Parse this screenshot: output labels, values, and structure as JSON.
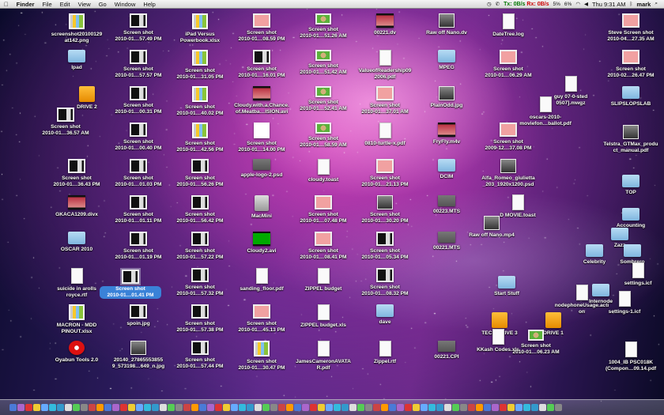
{
  "menubar": {
    "apple": "",
    "app": "Finder",
    "menus": [
      "File",
      "Edit",
      "View",
      "Go",
      "Window",
      "Help"
    ],
    "status": {
      "net_tx": "Tx:",
      "net_rx": "Rx:",
      "net_rate_tx": "0B/s",
      "net_rate_rx": "0B/s",
      "cpu1": "5%",
      "cpu2": "6%",
      "clock": "Thu 9:31 AM",
      "user": "mark"
    }
  },
  "items": [
    {
      "label": "screenshot20100129\nat142.png",
      "icon": "sheet"
    },
    {
      "label": "Ipad",
      "icon": "folder"
    },
    {
      "label": "DRIVE 2",
      "icon": "drive"
    },
    {
      "label": "Screen shot\n2010-01…36.57 AM",
      "icon": "screenshot"
    },
    {
      "label": "Screen shot\n2010-01…36.43 PM",
      "icon": "screenshot"
    },
    {
      "label": "GKACA1209.divx",
      "icon": "video"
    },
    {
      "label": "OSCAR 2010",
      "icon": "folder"
    },
    {
      "label": "suicide in arolls\nroyce.rtf",
      "icon": "doc"
    },
    {
      "label": "MACRON - MDD\nPINOUT.xlsx",
      "icon": "sheet"
    },
    {
      "label": "Oyabun Tools 2.0",
      "icon": "red"
    },
    {
      "label": "Screen shot\n2010-01…57.49 PM",
      "icon": "screenshot"
    },
    {
      "label": "Screen shot\n2010-01…57.57 PM",
      "icon": "screenshot"
    },
    {
      "label": "Screen shot\n2010-01…00.31 PM",
      "icon": "screenshot"
    },
    {
      "label": "Screen shot\n2010-01…00.40 PM",
      "icon": "screenshot"
    },
    {
      "label": "Screen shot\n2010-01…01.03 PM",
      "icon": "screenshot"
    },
    {
      "label": "Screen shot\n2010-01…01.11 PM",
      "icon": "screenshot"
    },
    {
      "label": "Screen shot\n2010-01…01.19 PM",
      "icon": "screenshot"
    },
    {
      "label": "Screen shot\n2010-01…01.41 PM",
      "icon": "screenshot",
      "selected": true
    },
    {
      "label": "spoin.jpg",
      "icon": "screenshot"
    },
    {
      "label": "20140_27865553855\n9_573198…649_n.jpg",
      "icon": "photo"
    },
    {
      "label": "iPad Versus\nPowerbook.xlsx",
      "icon": "sheet"
    },
    {
      "label": "Screen shot\n2010-01…31.05 PM",
      "icon": "sheet"
    },
    {
      "label": "Screen shot\n2010-01…40.02 PM",
      "icon": "sheet"
    },
    {
      "label": "Screen shot\n2010-01…42.56 PM",
      "icon": "sheet"
    },
    {
      "label": "Screen shot\n2010-01…56.26 PM",
      "icon": "screenshot"
    },
    {
      "label": "Screen shot\n2010-01…56.42 PM",
      "icon": "screenshot"
    },
    {
      "label": "Screen shot\n2010-01…57.22 PM",
      "icon": "screenshot"
    },
    {
      "label": "Screen shot\n2010-01…57.32 PM",
      "icon": "screenshot"
    },
    {
      "label": "Screen shot\n2010-01…57.38 PM",
      "icon": "screenshot"
    },
    {
      "label": "Screen shot\n2010-01…57.44 PM",
      "icon": "screenshot"
    },
    {
      "label": "Screen shot\n2010-01…08.59 PM",
      "icon": "pinkshot"
    },
    {
      "label": "Screen shot\n2010-01…16.01 PM",
      "icon": "screenshot"
    },
    {
      "label": "Cloudy.with.a.Chance.\nof.Meatba…ISION.avi",
      "icon": "video"
    },
    {
      "label": "Screen shot\n2010-01…14.00 PM",
      "icon": "apple"
    },
    {
      "label": "apple-logo-2.psd",
      "icon": "gray"
    },
    {
      "label": "MacMini",
      "icon": "hd"
    },
    {
      "label": "Cloudy2.avi",
      "icon": "green"
    },
    {
      "label": "sanding_floor.pdf",
      "icon": "doc"
    },
    {
      "label": "Screen shot\n2010-01…45.13 PM",
      "icon": "pinkshot"
    },
    {
      "label": "Screen shot\n2010-01…30.47 PM",
      "icon": "sheet"
    },
    {
      "label": "Screen shot\n2010-01…51.26 AM",
      "icon": "greenshot"
    },
    {
      "label": "Screen shot\n2010-01…51.42 AM",
      "icon": "greenshot"
    },
    {
      "label": "Screen shot\n2010-01…52.41 AM",
      "icon": "greenshot"
    },
    {
      "label": "Screen shot\n2010-01…58.59 AM",
      "icon": "greenshot"
    },
    {
      "label": "cloudy.toast",
      "icon": "doc"
    },
    {
      "label": "Screen shot\n2010-01…07.48 PM",
      "icon": "pinkshot"
    },
    {
      "label": "Screen shot\n2010-01…08.41 PM",
      "icon": "pinkshot"
    },
    {
      "label": "ZIPPEL budget",
      "icon": "doc"
    },
    {
      "label": "ZIPPEL budget.xls",
      "icon": "doc"
    },
    {
      "label": "JamesCameronAVATA\nR.pdf",
      "icon": "doc"
    },
    {
      "label": "00221.dv",
      "icon": "video"
    },
    {
      "label": "ValueofReadership09\n2006.pdf",
      "icon": "doc"
    },
    {
      "label": "Screen shot\n2010-01…37.01 AM",
      "icon": "pinkshot"
    },
    {
      "label": "0810-turtle-x.pdf",
      "icon": "doc"
    },
    {
      "label": "Screen shot\n2010-01…21.13 PM",
      "icon": "pinkshot"
    },
    {
      "label": "Screen shot\n2010-01…30.20 PM",
      "icon": "photo"
    },
    {
      "label": "Screen shot\n2010-01…05.34 PM",
      "icon": "screenshot"
    },
    {
      "label": "Screen shot\n2010-01…08.32 PM",
      "icon": "screenshot"
    },
    {
      "label": "dave",
      "icon": "folder"
    },
    {
      "label": "Zippel.rtf",
      "icon": "doc"
    },
    {
      "label": "Raw off Nano.dv",
      "icon": "photo"
    },
    {
      "label": "MPEG",
      "icon": "folder"
    },
    {
      "label": "PlainOdd.jpg",
      "icon": "photo"
    },
    {
      "label": "FryFly.m4v",
      "icon": "video"
    },
    {
      "label": "DCIM",
      "icon": "folder"
    },
    {
      "label": "00223.MTS",
      "icon": "gray"
    },
    {
      "label": "00221.MTS",
      "icon": "gray"
    },
    {
      "label": "00221.CPI",
      "icon": "gray"
    },
    {
      "label": "DateTree.log",
      "icon": "doc"
    },
    {
      "label": "Screen shot\n2010-01…06.29 AM",
      "icon": "pinkshot"
    },
    {
      "label": "Screen shot\n2009-12…37.08 PM",
      "icon": "pinkshot"
    },
    {
      "label": "Alfa_Romeo_giulietta\n_203_1920x1200.psd",
      "icon": "photo"
    },
    {
      "label": "D MOVIE.toast",
      "icon": "doc"
    },
    {
      "label": "Raw off Nano.mp4",
      "icon": "photo"
    },
    {
      "label": "Start Stuff",
      "icon": "folder"
    },
    {
      "label": "TECH DRIVE 3",
      "icon": "drive"
    },
    {
      "label": "KKash Codes.xls",
      "icon": "doc"
    },
    {
      "label": "DRIVE 1",
      "icon": "drive"
    },
    {
      "label": "Screen shot\n2010-01…06.23 AM",
      "icon": "greenshot"
    },
    {
      "label": "Steve Screen shot\n2010-04…27.35 AM",
      "icon": "pinkshot"
    },
    {
      "label": "Screen shot\n2010-02…26.47 PM",
      "icon": "pinkshot"
    },
    {
      "label": "SLIPSLOPSLAB",
      "icon": "folder"
    },
    {
      "label": "Telstra_GTMax_produ\nct_manual.pdf",
      "icon": "photo"
    },
    {
      "label": "guy 07-0-sted\n0507].mwgz",
      "icon": "doc"
    },
    {
      "label": "oscars-2010-\nmoviefon…ballot.pdf",
      "icon": "doc"
    },
    {
      "label": "TOP",
      "icon": "folder"
    },
    {
      "label": "Accounting",
      "icon": "folder"
    },
    {
      "label": "Zazz",
      "icon": "folder"
    },
    {
      "label": "Celebrity",
      "icon": "folder"
    },
    {
      "label": "Sombrero",
      "icon": "folder"
    },
    {
      "label": "settings.icf",
      "icon": "doc"
    },
    {
      "label": "nodephoneUsage.acti\non",
      "icon": "doc"
    },
    {
      "label": "Internode",
      "icon": "folder"
    },
    {
      "label": "settings-1.icf",
      "icon": "doc"
    },
    {
      "label": "1004_IB PSC018K\n(Compon…09.14.pdf",
      "icon": "doc"
    }
  ],
  "dock": {
    "count": 70
  }
}
